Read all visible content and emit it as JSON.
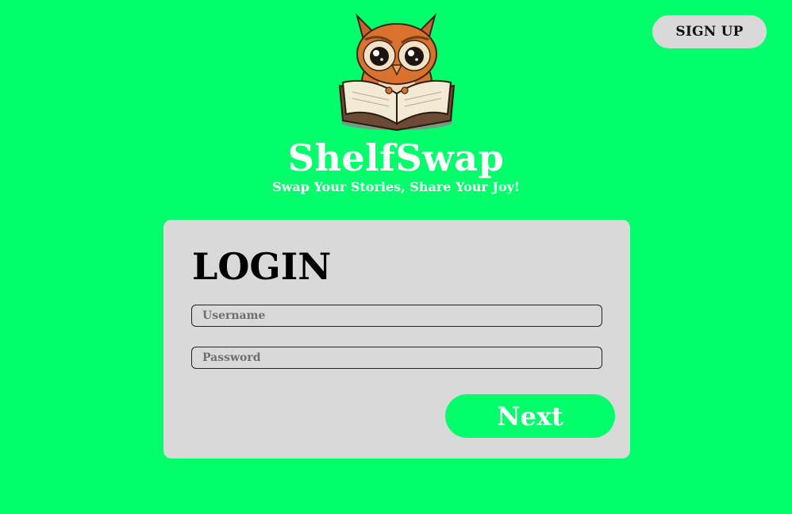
{
  "header": {
    "signup_label": "SIGN UP"
  },
  "brand": {
    "logo_icon": "owl-reading-book-icon",
    "name": "ShelfSwap",
    "tagline": "Swap Your Stories, Share Your Joy!"
  },
  "login": {
    "title": "LOGIN",
    "username": {
      "value": "",
      "placeholder": "Username"
    },
    "password": {
      "value": "",
      "placeholder": "Password"
    },
    "next_label": "Next"
  },
  "colors": {
    "background": "#00ff6a",
    "card": "#d9d9d9",
    "accent": "#00ff6a",
    "text_light": "#ffffff",
    "text_dark": "#000000"
  }
}
